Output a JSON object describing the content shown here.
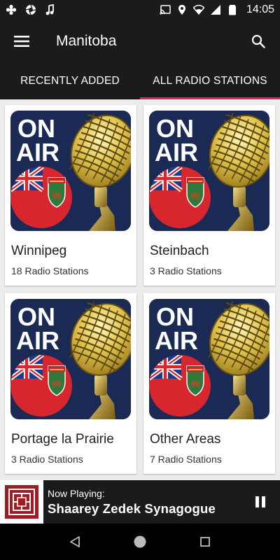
{
  "status_bar": {
    "time": "14:05",
    "left_icons": [
      "flower-icon",
      "aperture-icon",
      "music-note-icon"
    ],
    "right_icons": [
      "cast-icon",
      "location-icon",
      "wifi-icon",
      "signal-icon",
      "battery-icon"
    ]
  },
  "app_bar": {
    "title": "Manitoba",
    "menu_icon": "hamburger-menu-icon",
    "search_icon": "search-icon"
  },
  "tabs": [
    {
      "label": "RECENTLY ADDED",
      "active": false
    },
    {
      "label": "ALL RADIO STATIONS",
      "active": true
    }
  ],
  "cards": [
    {
      "name": "Winnipeg",
      "count": "18 Radio Stations",
      "art_text": [
        "ON",
        "AIR"
      ]
    },
    {
      "name": "Steinbach",
      "count": "3 Radio Stations",
      "art_text": [
        "ON",
        "AIR"
      ]
    },
    {
      "name": "Portage la Prairie",
      "count": "3 Radio Stations",
      "art_text": [
        "ON",
        "AIR"
      ]
    },
    {
      "name": "Other Areas",
      "count": "7 Radio Stations",
      "art_text": [
        "ON",
        "AIR"
      ]
    }
  ],
  "player": {
    "label": "Now Playing:",
    "title": "Shaarey Zedek Synagogue",
    "pause_icon": "pause-icon"
  },
  "colors": {
    "bar_background": "#1b1b1b",
    "tab_indicator": "#e2245a",
    "grid_background": "#ececec",
    "art_background": "#1a2a55",
    "flag_red": "#d8262f"
  }
}
